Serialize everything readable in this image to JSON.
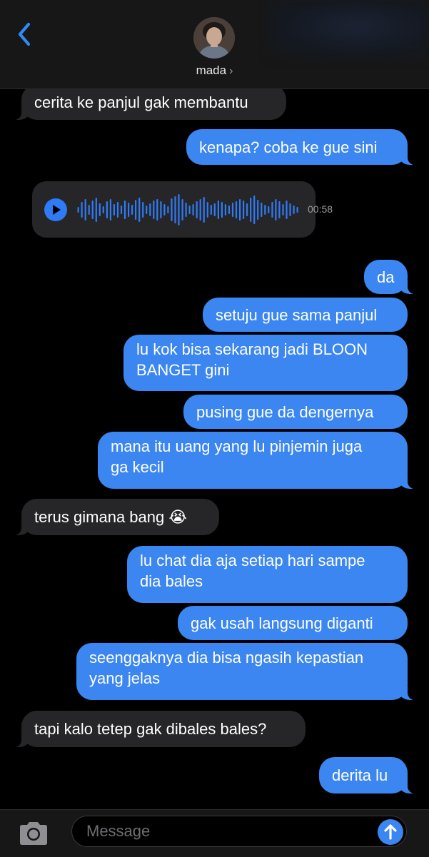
{
  "header": {
    "contact_name": "mada",
    "chevron": "›"
  },
  "icons": {
    "back": "chevron-left-icon",
    "camera": "camera-icon",
    "send": "arrow-up-icon",
    "play": "play-icon"
  },
  "colors": {
    "outgoing_bubble": "#3b86f0",
    "incoming_bubble": "#262628",
    "background": "#000000",
    "accent": "#2f7bf6"
  },
  "messages": [
    {
      "dir": "in",
      "text": "cerita ke panjul gak membantu"
    },
    {
      "dir": "out",
      "text": "kenapa? coba ke gue sini"
    },
    {
      "dir": "in",
      "type": "voice",
      "duration": "00:58"
    },
    {
      "dir": "out",
      "text": "da"
    },
    {
      "dir": "out",
      "text": "setuju gue sama panjul"
    },
    {
      "dir": "out",
      "lines": [
        "lu kok bisa sekarang jadi BLOON",
        "BANGET gini"
      ]
    },
    {
      "dir": "out",
      "text": "pusing gue da dengernya"
    },
    {
      "dir": "out",
      "lines": [
        "mana itu uang yang lu pinjemin juga",
        "ga kecil"
      ]
    },
    {
      "dir": "in",
      "text": "terus gimana bang 😭"
    },
    {
      "dir": "out",
      "lines": [
        "lu chat dia aja setiap hari sampe",
        "dia bales"
      ]
    },
    {
      "dir": "out",
      "text": "gak usah langsung diganti"
    },
    {
      "dir": "out",
      "lines": [
        "seenggaknya dia bisa ngasih kepastian",
        "yang jelas"
      ]
    },
    {
      "dir": "in",
      "text": "tapi kalo tetep gak dibales bales?"
    },
    {
      "dir": "out",
      "text": "derita lu"
    }
  ],
  "composer": {
    "placeholder": "Message"
  }
}
